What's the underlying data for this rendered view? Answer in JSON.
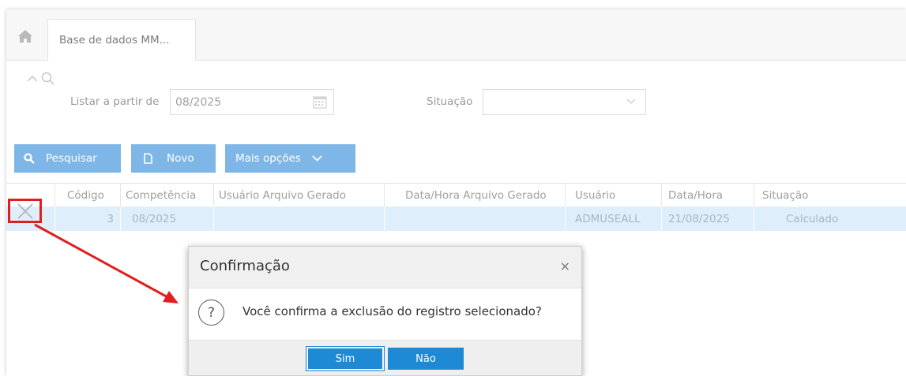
{
  "tabs": [
    {
      "label": "Base de dados MM..."
    }
  ],
  "filters": {
    "listar_label": "Listar a partir de",
    "listar_value": "08/2025",
    "situacao_label": "Situação",
    "situacao_value": ""
  },
  "toolbar": {
    "pesquisar": "Pesquisar",
    "novo": "Novo",
    "mais_opcoes": "Mais opções"
  },
  "table": {
    "headers": [
      "Código",
      "Competência",
      "Usuário Arquivo Gerado",
      "Data/Hora Arquivo Gerado",
      "Usuário",
      "Data/Hora",
      "Situação"
    ],
    "rows": [
      {
        "codigo": "3",
        "competencia": "08/2025",
        "usuario_arquivo": "",
        "data_hora_arquivo": "",
        "usuario": "ADMUSEALL",
        "data_hora": "21/08/2025",
        "situacao": "Calculado"
      }
    ]
  },
  "dialog": {
    "title": "Confirmação",
    "close": "×",
    "message": "Você confirma a exclusão do registro selecionado?",
    "yes": "Sim",
    "no": "Não"
  },
  "colors": {
    "accent": "#1e8ad6",
    "button_light": "#7eb6e8",
    "row_selected": "#dfeefb",
    "annotation": "#e01e1e"
  }
}
